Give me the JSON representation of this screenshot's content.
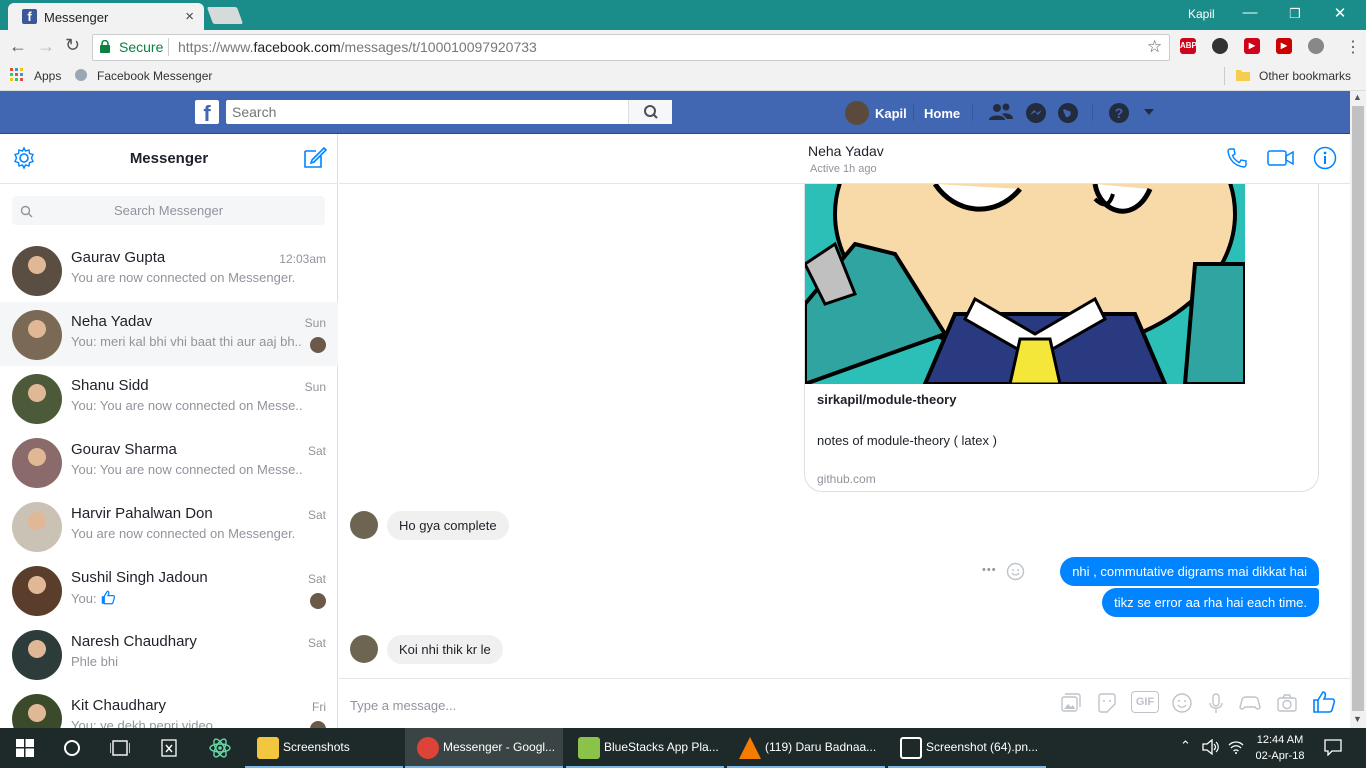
{
  "browser": {
    "tab_title": "Messenger",
    "tab_close": "×",
    "profile_name": "Kapil",
    "window_controls": [
      "—",
      "❐",
      "✕"
    ],
    "secure_label": "Secure",
    "url_prefix": "https://www.",
    "url_domain": "facebook.com",
    "url_path": "/messages/t/100010097920733",
    "extensions": [
      {
        "name": "adblock-plus-icon",
        "label": "ABP",
        "color": "#d0021b"
      },
      {
        "name": "ghostery-icon",
        "label": "",
        "color": "#333333"
      },
      {
        "name": "video-extension-icon",
        "label": "▶",
        "color": "#d0021b"
      },
      {
        "name": "youtube-icon",
        "label": "▶",
        "color": "#cc0000"
      },
      {
        "name": "extension-icon",
        "label": "",
        "color": "#888888"
      }
    ]
  },
  "bookmarks": {
    "apps": "Apps",
    "messenger": "Facebook Messenger",
    "other": "Other bookmarks"
  },
  "facebook": {
    "search_placeholder": "Search",
    "user_name": "Kapil",
    "home": "Home"
  },
  "sidebar": {
    "title": "Messenger",
    "search_placeholder": "Search Messenger",
    "conversations": [
      {
        "name": "Gaurav Gupta",
        "preview": "You are now connected on Messenger.",
        "time": "12:03am",
        "avatar_color": "#5a4d42",
        "active": false,
        "seen": false
      },
      {
        "name": "Neha Yadav",
        "preview": "You: meri kal bhi vhi baat thi aur aaj bh...",
        "time": "Sun",
        "avatar_color": "#7a6a55",
        "active": true,
        "seen": true
      },
      {
        "name": "Shanu Sidd",
        "preview": "You: You are now connected on Messe...",
        "time": "Sun",
        "avatar_color": "#4d5a3a",
        "active": false,
        "seen": false
      },
      {
        "name": "Gourav Sharma",
        "preview": "You: You are now connected on Messe...",
        "time": "Sat",
        "avatar_color": "#8a6a6a",
        "active": false,
        "seen": false
      },
      {
        "name": "Harvir Pahalwan Don",
        "preview": "You are now connected on Messenger.",
        "time": "Sat",
        "avatar_color": "#c9c2b5",
        "active": false,
        "seen": false
      },
      {
        "name": "Sushil Singh Jadoun",
        "preview": "You: ",
        "time": "Sat",
        "avatar_color": "#5a3d2a",
        "active": false,
        "seen": true,
        "like": true
      },
      {
        "name": "Naresh Chaudhary",
        "preview": "Phle bhi",
        "time": "Sat",
        "avatar_color": "#2d3b3a",
        "active": false,
        "seen": false
      },
      {
        "name": "Kit Chaudhary",
        "preview": "You: ye dekh pepri video",
        "time": "Fri",
        "avatar_color": "#3b4a2a",
        "active": false,
        "seen": true
      }
    ]
  },
  "chat": {
    "contact_name": "Neha Yadav",
    "status": "Active 1h ago",
    "link_card": {
      "title": "sirkapil/module-theory",
      "description": "notes of module-theory ( latex )",
      "domain": "github.com"
    },
    "messages": [
      {
        "from": "them",
        "text": "Ho gya complete"
      },
      {
        "from": "me",
        "text": "nhi , commutative digrams mai dikkat hai"
      },
      {
        "from": "me",
        "text": "tikz se error aa rha hai each time."
      },
      {
        "from": "them",
        "text": "Koi nhi thik kr le"
      }
    ],
    "more_dots": "•••",
    "composer_placeholder": "Type a message...",
    "gif_label": "GIF"
  },
  "taskbar": {
    "items": [
      {
        "label": "Screenshots",
        "icon": "folder-icon",
        "color": "#f3c640"
      },
      {
        "label": "Messenger - Googl...",
        "icon": "chrome-icon",
        "color": "#db4437",
        "active": true
      },
      {
        "label": "BlueStacks App Pla...",
        "icon": "bluestacks-icon",
        "color": "#8bc34a"
      },
      {
        "label": "(119) Daru Badnaa...",
        "icon": "vlc-icon",
        "color": "#f57c00"
      },
      {
        "label": "Screenshot (64).pn...",
        "icon": "photos-icon",
        "color": "#ffffff"
      }
    ],
    "time": "12:44 AM",
    "date": "02-Apr-18"
  }
}
